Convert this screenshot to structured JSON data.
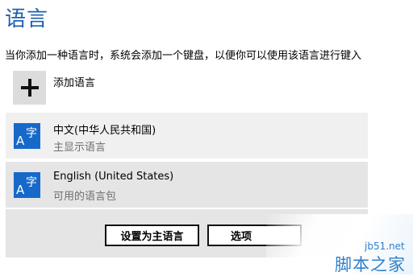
{
  "page": {
    "title": "语言",
    "description": "当你添加一种语言时，系统会添加一个键盘，以便你可以使用该语言进行键入"
  },
  "add_language": {
    "label": "添加语言",
    "icon": "plus-icon"
  },
  "languages": [
    {
      "icon_letter": "A",
      "icon_char": "字",
      "name": "中文(中华人民共和国)",
      "status": "主显示语言"
    },
    {
      "icon_letter": "A",
      "icon_char": "字",
      "name": "English (United States)",
      "status": "可用的语言包"
    }
  ],
  "actions": {
    "set_primary": "设置为主语言",
    "options": "选项"
  },
  "watermark": {
    "site": "jb51.net",
    "brand": "脚本之家"
  },
  "colors": {
    "accent": "#1e5fb0",
    "language_icon_bg": "#1769c9",
    "selected_bg": "#e5e5e5",
    "row_bg": "#f0f0f0"
  }
}
